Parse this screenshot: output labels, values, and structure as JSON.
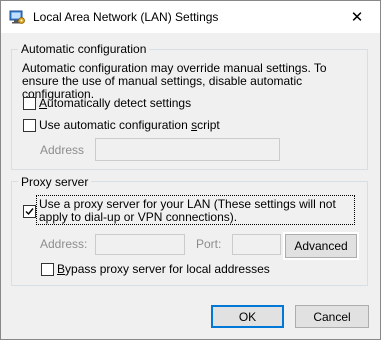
{
  "window": {
    "title": "Local Area Network (LAN) Settings",
    "close_glyph": "✕"
  },
  "auto_config": {
    "legend": "Automatic configuration",
    "description": "Automatic configuration may override manual settings.  To ensure the use of manual settings, disable automatic configuration.",
    "detect_label": "Automatically detect settings",
    "detect_checked": false,
    "script_label": "Use automatic configuration script",
    "script_checked": false,
    "address_label": "Address",
    "address_value": ""
  },
  "proxy": {
    "legend": "Proxy server",
    "use_proxy_label": "Use a proxy server for your LAN (These settings will not apply to dial-up or VPN connections).",
    "use_proxy_checked": true,
    "address_label": "Address:",
    "address_value": "",
    "port_label": "Port:",
    "port_value": "",
    "advanced_label": "Advanced",
    "bypass_label": "Bypass proxy server for local addresses",
    "bypass_checked": false
  },
  "buttons": {
    "ok": "OK",
    "cancel": "Cancel"
  },
  "icons": {
    "app": "network-settings-icon",
    "close": "close-icon"
  }
}
